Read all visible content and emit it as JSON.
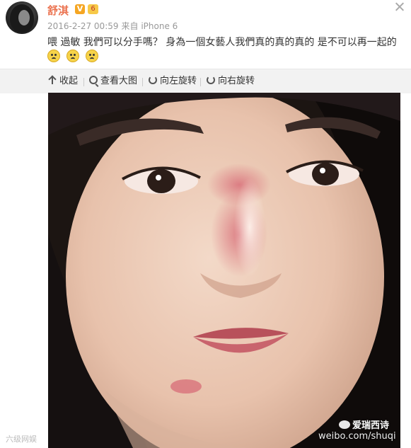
{
  "post": {
    "username": "舒淇",
    "verified_badge": "V",
    "level_badge": "6",
    "timestamp": "2016-2-27 00:59",
    "source": "来自 iPhone 6",
    "text": "喂 過敏 我們可以分手嗎？ 身為一個女藝人我們真的真的真的 是不可以再一起的",
    "emojis": [
      "crying-face",
      "crying-face",
      "crying-face"
    ]
  },
  "toolbar": {
    "collapse_label": "收起",
    "view_large_label": "查看大图",
    "rotate_left_label": "向左旋转",
    "rotate_right_label": "向右旋转"
  },
  "image": {
    "subject": "close-up selfie of a woman's face with red allergy rash on nose",
    "watermark_url": "weibo.com/shuqi",
    "wechat_watermark": "爱瑞西诗",
    "corner_watermark": "六级网娱"
  },
  "colors": {
    "username": "#eb7350",
    "toolbar_bg": "#f2f2f2",
    "meta_text": "#999999"
  }
}
